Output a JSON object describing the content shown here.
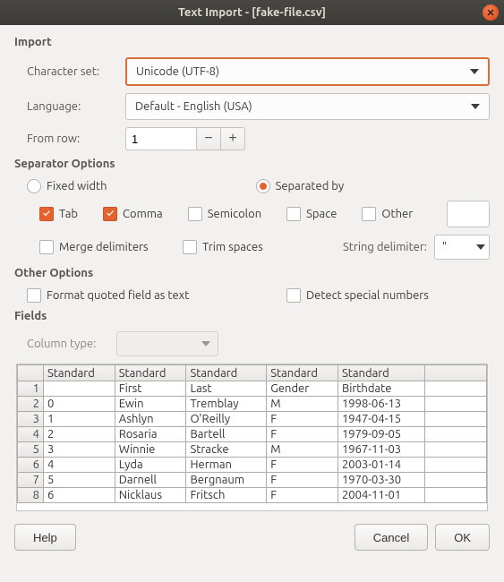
{
  "window": {
    "title": "Text Import - [fake-file.csv]"
  },
  "import": {
    "heading": "Import",
    "charset_label": "Character set:",
    "charset_value": "Unicode (UTF-8)",
    "language_label": "Language:",
    "language_value": "Default - English (USA)",
    "fromrow_label": "From row:",
    "fromrow_value": "1"
  },
  "sep": {
    "heading": "Separator Options",
    "fixed_label": "Fixed width",
    "fixed_checked": false,
    "separated_label": "Separated by",
    "separated_checked": true,
    "tab_label": "Tab",
    "tab_checked": true,
    "comma_label": "Comma",
    "comma_checked": true,
    "semicolon_label": "Semicolon",
    "semicolon_checked": false,
    "space_label": "Space",
    "space_checked": false,
    "other_label": "Other",
    "other_checked": false,
    "other_value": "",
    "merge_label": "Merge delimiters",
    "merge_checked": false,
    "trim_label": "Trim spaces",
    "trim_checked": false,
    "stringdelim_label": "String delimiter:",
    "stringdelim_value": "\""
  },
  "other": {
    "heading": "Other Options",
    "quoted_label": "Format quoted field as text",
    "quoted_checked": false,
    "detect_label": "Detect special numbers",
    "detect_checked": false
  },
  "fields": {
    "heading": "Fields",
    "coltype_label": "Column type:",
    "coltype_value": "",
    "headers": [
      "Standard",
      "Standard",
      "Standard",
      "Standard",
      "Standard"
    ],
    "rows": [
      [
        "",
        "First",
        "Last",
        "Gender",
        "Birthdate"
      ],
      [
        "0",
        "Ewin",
        "Tremblay",
        "M",
        "1998-06-13"
      ],
      [
        "1",
        "Ashlyn",
        "O'Reilly",
        "F",
        "1947-04-15"
      ],
      [
        "2",
        "Rosaria",
        "Bartell",
        "F",
        "1979-09-05"
      ],
      [
        "3",
        "Winnie",
        "Stracke",
        "M",
        "1967-11-03"
      ],
      [
        "4",
        "Lyda",
        "Herman",
        "F",
        "2003-01-14"
      ],
      [
        "5",
        "Darnell",
        "Bergnaum",
        "F",
        "1970-03-30"
      ],
      [
        "6",
        "Nicklaus",
        "Fritsch",
        "F",
        "2004-11-01"
      ]
    ]
  },
  "footer": {
    "help": "Help",
    "cancel": "Cancel",
    "ok": "OK"
  }
}
